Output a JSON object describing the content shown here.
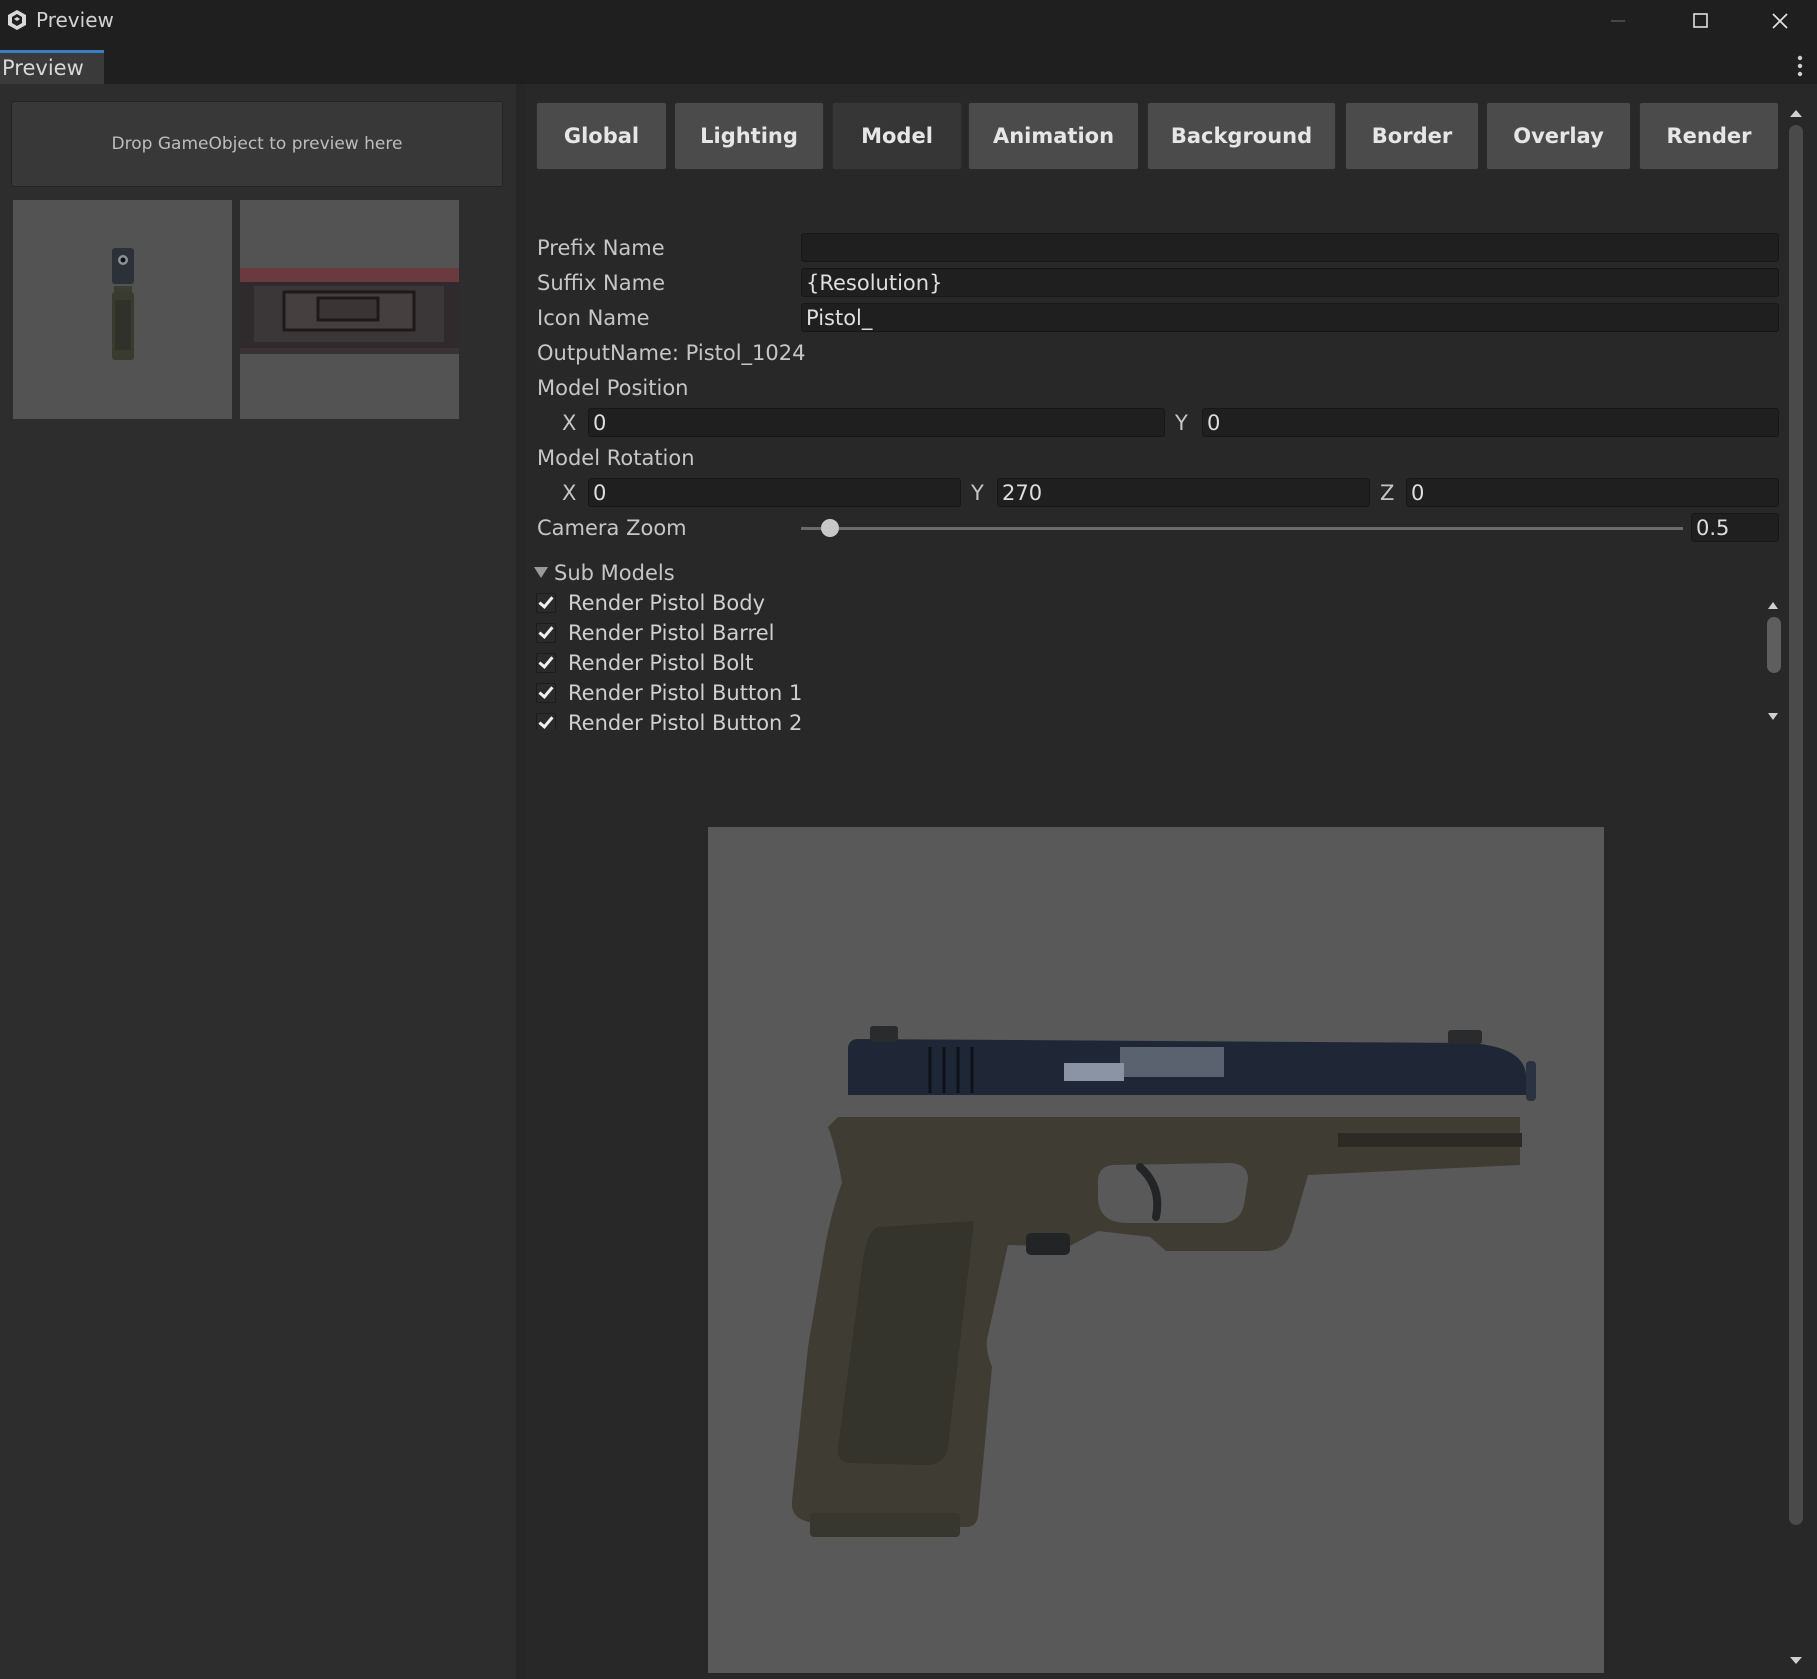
{
  "window": {
    "title": "Preview",
    "tab_label": "Preview"
  },
  "left_panel": {
    "drop_zone_text": "Drop GameObject to preview here",
    "thumbnails": [
      "pistol-front-thumbnail",
      "ammo-box-thumbnail"
    ]
  },
  "tabs": [
    {
      "label": "Global",
      "active": false
    },
    {
      "label": "Lighting",
      "active": false
    },
    {
      "label": "Model",
      "active": true
    },
    {
      "label": "Animation",
      "active": false
    },
    {
      "label": "Background",
      "active": false
    },
    {
      "label": "Border",
      "active": false
    },
    {
      "label": "Overlay",
      "active": false
    },
    {
      "label": "Render",
      "active": false
    }
  ],
  "model": {
    "prefix_label": "Prefix Name",
    "prefix_value": "",
    "suffix_label": "Suffix Name",
    "suffix_value": "{Resolution}",
    "icon_label": "Icon Name",
    "icon_value": "Pistol_",
    "output_name": "OutputName: Pistol_1024",
    "position_label": "Model Position",
    "position": {
      "x_label": "X",
      "x": "0",
      "y_label": "Y",
      "y": "0"
    },
    "rotation_label": "Model Rotation",
    "rotation": {
      "x_label": "X",
      "x": "0",
      "y_label": "Y",
      "y": "270",
      "z_label": "Z",
      "z": "0"
    },
    "zoom_label": "Camera Zoom",
    "zoom_value": "0.5",
    "zoom_fraction": 0.033
  },
  "sub_models": {
    "header": "Sub Models",
    "items": [
      {
        "label": "Render Pistol Body",
        "checked": true
      },
      {
        "label": "Render Pistol Barrel",
        "checked": true
      },
      {
        "label": "Render Pistol Bolt",
        "checked": true
      },
      {
        "label": "Render Pistol Button 1",
        "checked": true
      },
      {
        "label": "Render Pistol Button 2",
        "checked": true
      }
    ]
  },
  "preview": {
    "subject": "pistol-model"
  },
  "colors": {
    "accent": "#3b7dbf",
    "preview_bg": "#595959",
    "slide": "#1f2737",
    "frame": "#3f3d33"
  }
}
